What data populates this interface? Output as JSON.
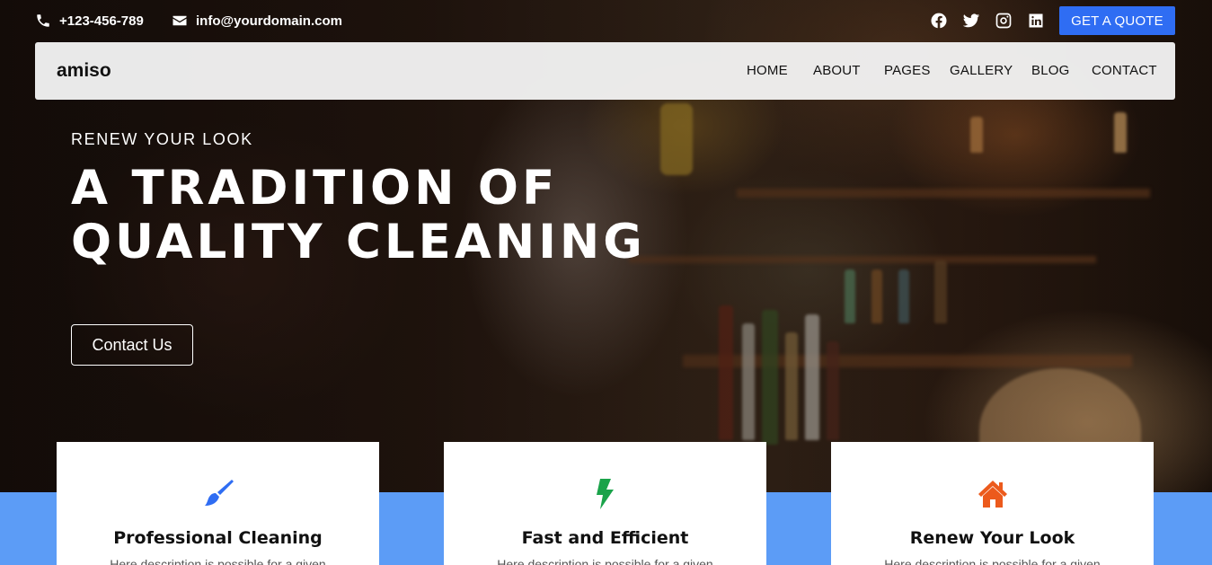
{
  "topbar": {
    "phone": "+123-456-789",
    "email": "info@yourdomain.com",
    "quote_button": "GET A QUOTE"
  },
  "navbar": {
    "brand": "amiso",
    "links": [
      "HOME",
      "ABOUT",
      "PAGES",
      "GALLERY",
      "BLOG",
      "CONTACT"
    ]
  },
  "hero": {
    "eyebrow": "RENEW YOUR LOOK",
    "headline": "A TRADITION OF QUALITY CLEANING",
    "cta": "Contact Us"
  },
  "features": [
    {
      "title": "Professional Cleaning",
      "icon": "brush-icon",
      "color": "#2f6df3",
      "text": "Here description is possible for a given"
    },
    {
      "title": "Fast and Efficient",
      "icon": "bolt-icon",
      "color": "#1aa34a",
      "text": "Here description is possible for a given"
    },
    {
      "title": "Renew Your Look",
      "icon": "home-icon",
      "color": "#ec5a1c",
      "text": "Here description is possible for a given"
    }
  ],
  "colors": {
    "accent": "#2f6df3",
    "band": "#5c9cf6"
  }
}
